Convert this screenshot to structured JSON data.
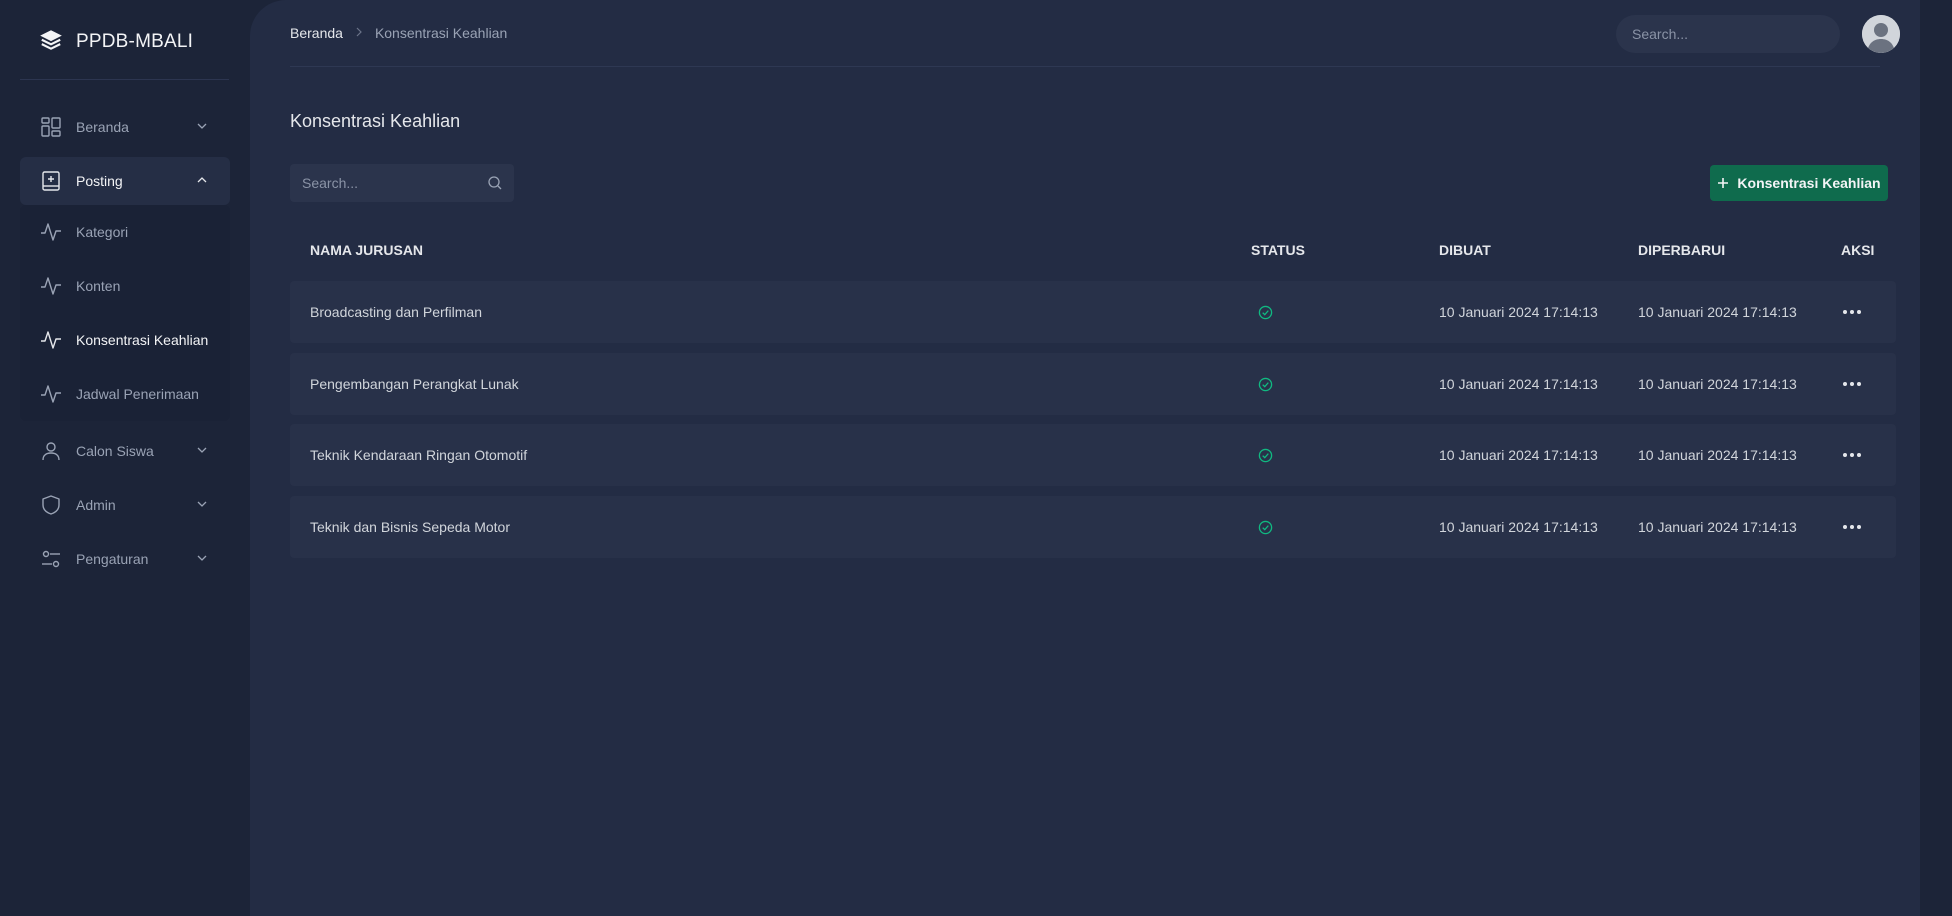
{
  "app": {
    "brand": "PPDB-MBALI"
  },
  "sidebar": {
    "items": [
      {
        "label": "Beranda",
        "icon": "dashboard-icon",
        "expanded": false
      },
      {
        "label": "Posting",
        "icon": "book-plus-icon",
        "expanded": true,
        "children": [
          {
            "label": "Kategori",
            "icon": "activity-icon"
          },
          {
            "label": "Konten",
            "icon": "activity-icon"
          },
          {
            "label": "Konsentrasi Keahlian",
            "icon": "activity-icon",
            "active": true
          },
          {
            "label": "Jadwal Penerimaan",
            "icon": "activity-icon"
          }
        ]
      },
      {
        "label": "Calon Siswa",
        "icon": "user-icon",
        "expanded": false
      },
      {
        "label": "Admin",
        "icon": "shield-icon",
        "expanded": false
      },
      {
        "label": "Pengaturan",
        "icon": "sliders-icon",
        "expanded": false
      }
    ]
  },
  "header": {
    "breadcrumb": [
      "Beranda",
      "Konsentrasi Keahlian"
    ],
    "search_placeholder": "Search..."
  },
  "main": {
    "title": "Konsentrasi Keahlian",
    "search_placeholder": "Search...",
    "add_button_label": "Konsentrasi Keahlian",
    "columns": [
      "NAMA JURUSAN",
      "STATUS",
      "DIBUAT",
      "DIPERBARUI",
      "AKSI"
    ],
    "rows": [
      {
        "name": "Broadcasting dan Perfilman",
        "status": "active",
        "created": "10 Januari 2024 17:14:13",
        "updated": "10 Januari 2024 17:14:13"
      },
      {
        "name": "Pengembangan Perangkat Lunak",
        "status": "active",
        "created": "10 Januari 2024 17:14:13",
        "updated": "10 Januari 2024 17:14:13"
      },
      {
        "name": "Teknik Kendaraan Ringan Otomotif",
        "status": "active",
        "created": "10 Januari 2024 17:14:13",
        "updated": "10 Januari 2024 17:14:13"
      },
      {
        "name": "Teknik dan Bisnis Sepeda Motor",
        "status": "active",
        "created": "10 Januari 2024 17:14:13",
        "updated": "10 Januari 2024 17:14:13"
      }
    ]
  },
  "colors": {
    "accent": "#0f6b4d",
    "status_ok": "#10b981"
  }
}
